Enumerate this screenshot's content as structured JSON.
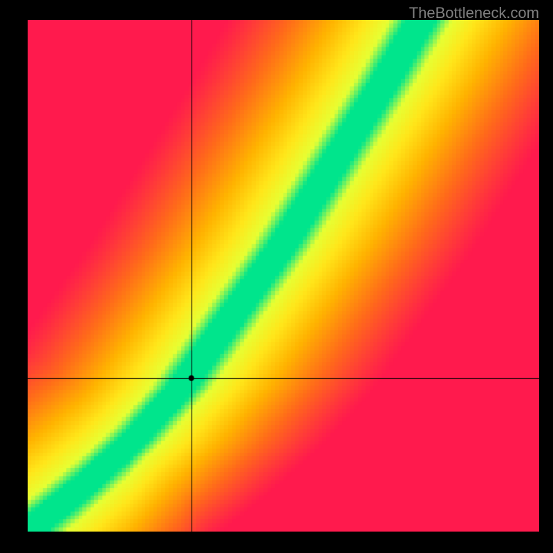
{
  "watermark": "TheBottleneck.com",
  "chart_data": {
    "type": "heatmap",
    "title": "",
    "xlabel": "",
    "ylabel": "",
    "xlim": [
      0,
      1
    ],
    "ylim": [
      0,
      1
    ],
    "crosshair": {
      "x": 0.32,
      "y": 0.3
    },
    "marker": {
      "x": 0.32,
      "y": 0.3
    },
    "optimal_curve": {
      "description": "Optimal diagonal band (green) through heatmap; below-left and upper regions fade toward red via orange/yellow.",
      "points": [
        {
          "x": 0.0,
          "y": 0.0
        },
        {
          "x": 0.1,
          "y": 0.08
        },
        {
          "x": 0.2,
          "y": 0.17
        },
        {
          "x": 0.3,
          "y": 0.28
        },
        {
          "x": 0.4,
          "y": 0.42
        },
        {
          "x": 0.5,
          "y": 0.56
        },
        {
          "x": 0.6,
          "y": 0.72
        },
        {
          "x": 0.7,
          "y": 0.88
        },
        {
          "x": 0.77,
          "y": 1.0
        }
      ]
    },
    "color_stops": [
      {
        "value": 0.0,
        "color": "#ff1a4d"
      },
      {
        "value": 0.3,
        "color": "#ff6a1a"
      },
      {
        "value": 0.55,
        "color": "#ffb300"
      },
      {
        "value": 0.75,
        "color": "#ffe61a"
      },
      {
        "value": 0.9,
        "color": "#e6ff33"
      },
      {
        "value": 1.0,
        "color": "#00e58c"
      }
    ],
    "band_width": 0.055
  }
}
